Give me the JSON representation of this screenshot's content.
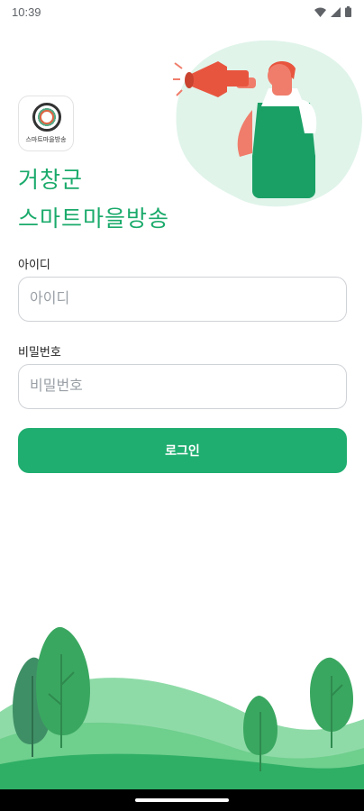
{
  "status_bar": {
    "time": "10:39"
  },
  "logo": {
    "caption": "스마트마을방송"
  },
  "title": {
    "line1": "거창군",
    "line2": "스마트마을방송"
  },
  "form": {
    "id_label": "아이디",
    "id_placeholder": "아이디",
    "id_value": "",
    "password_label": "비밀번호",
    "password_placeholder": "비밀번호",
    "password_value": "",
    "login_label": "로그인"
  },
  "colors": {
    "accent": "#1fae70",
    "title": "#1aaa6b",
    "hero_bg": "#e0f4ea"
  },
  "icons": [
    "wifi-icon",
    "signal-icon",
    "battery-icon",
    "megaphone-icon"
  ]
}
